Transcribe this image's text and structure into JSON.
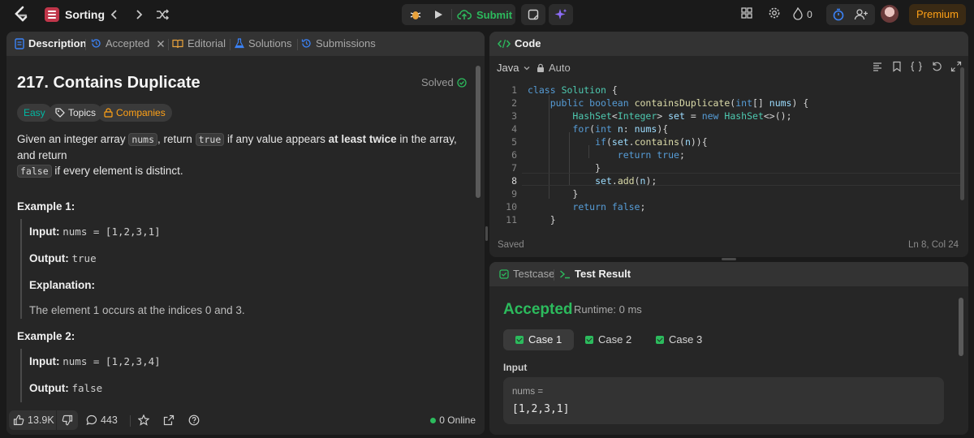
{
  "nav": {
    "problem_list_title": "Sorting",
    "submit_label": "Submit",
    "streak_count": "0",
    "premium_label": "Premium"
  },
  "description": {
    "tabs": {
      "description": "Description",
      "accepted": "Accepted",
      "editorial": "Editorial",
      "solutions": "Solutions",
      "submissions": "Submissions"
    },
    "title": "217. Contains Duplicate",
    "solved_label": "Solved",
    "tags": {
      "difficulty": "Easy",
      "topics": "Topics",
      "companies": "Companies"
    },
    "statement": {
      "p1": "Given an integer array ",
      "code1": "nums",
      "p2": ", return ",
      "code2": "true",
      "p3": " if any value appears ",
      "bold1": "at least twice",
      "p4": " in the array, and return",
      "code3": "false",
      "p5": " if every element is distinct."
    },
    "example1": {
      "heading": "Example 1:",
      "input_label": "Input:",
      "input_value": "nums = [1,2,3,1]",
      "output_label": "Output:",
      "output_value": "true",
      "explanation_label": "Explanation:",
      "explanation_text": "The element 1 occurs at the indices 0 and 3."
    },
    "example2": {
      "heading": "Example 2:",
      "input_label": "Input:",
      "input_value": "nums = [1,2,3,4]",
      "output_label": "Output:",
      "output_value": "false"
    },
    "footer": {
      "likes": "13.9K",
      "comments": "443",
      "online": "0 Online"
    }
  },
  "code": {
    "header": "Code",
    "language": "Java",
    "autocomplete": "Auto",
    "line_numbers": [
      "1",
      "2",
      "3",
      "4",
      "5",
      "6",
      "7",
      "8",
      "9",
      "10",
      "11"
    ],
    "status_saved": "Saved",
    "cursor_position": "Ln 8, Col 24"
  },
  "test": {
    "tabs": {
      "testcase": "Testcase",
      "result": "Test Result"
    },
    "verdict": "Accepted",
    "runtime": "Runtime: 0 ms",
    "cases": [
      "Case 1",
      "Case 2",
      "Case 3"
    ],
    "input_label": "Input",
    "var_name": "nums =",
    "var_value": "[1,2,3,1]"
  },
  "colors": {
    "accent_green": "#2cbb5d",
    "premium_orange": "#ffa116",
    "panel_bg": "#262626",
    "page_bg": "#1a1a1a"
  }
}
